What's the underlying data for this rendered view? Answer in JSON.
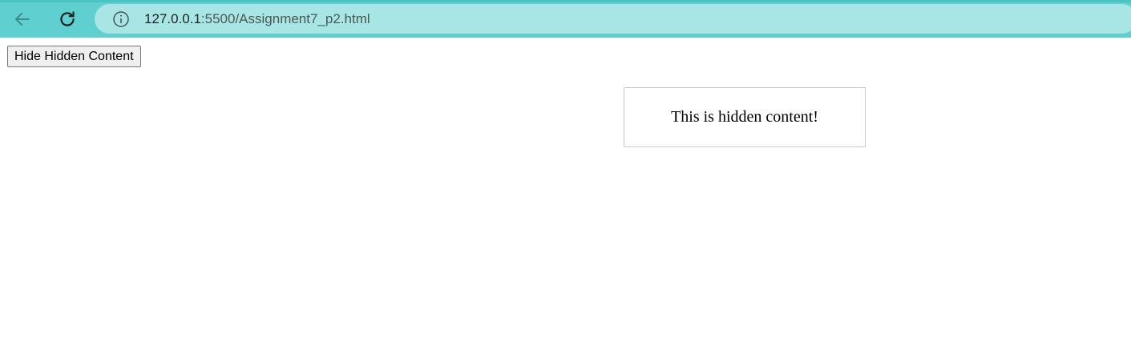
{
  "browser": {
    "back_icon": "arrow-left-icon",
    "reload_icon": "reload-icon",
    "info_icon": "info-circle-icon",
    "url_host": "127.0.0.1",
    "url_path": ":5500/Assignment7_p2.html",
    "toolbar_color": "#5fcfcf",
    "address_bar_color": "#a8e6e6"
  },
  "page": {
    "toggle_button_label": "Hide Hidden Content",
    "hidden_content_text": "This is hidden content!"
  }
}
